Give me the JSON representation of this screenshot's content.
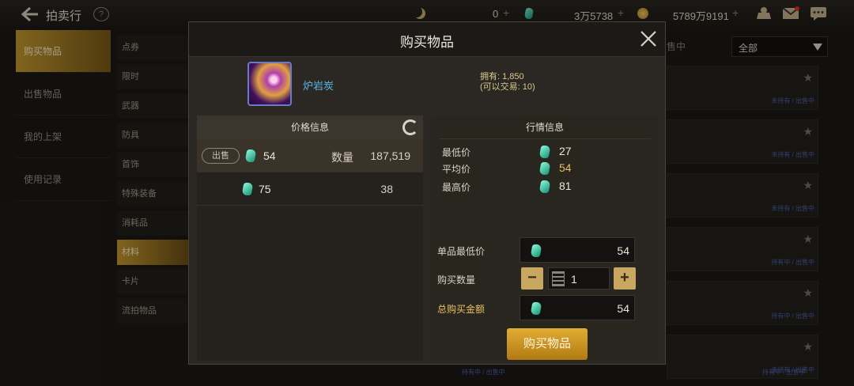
{
  "header": {
    "title": "拍卖行",
    "currency_moon": "0",
    "currency_gem": "3万5738",
    "currency_gold": "5789万9191"
  },
  "sidebar": {
    "items": [
      {
        "label": "购买物品"
      },
      {
        "label": "出售物品"
      },
      {
        "label": "我的上架"
      },
      {
        "label": "使用记录"
      }
    ]
  },
  "categories": [
    {
      "label": "点券"
    },
    {
      "label": "限时"
    },
    {
      "label": "武器"
    },
    {
      "label": "防具"
    },
    {
      "label": "首饰"
    },
    {
      "label": "特殊装备"
    },
    {
      "label": "消耗品"
    },
    {
      "label": "材料"
    },
    {
      "label": "卡片"
    },
    {
      "label": "流拍物品"
    }
  ],
  "list": {
    "filter_label": "售中",
    "filter_value": "全部",
    "row_statuses": [
      "未持有 / 出售中",
      "未持有 / 出售中",
      "未持有 / 出售中",
      "持有中 / 出售中",
      "持有中 / 出售中",
      "未持有 / 出售中"
    ],
    "bottom_status_left": "持有中 / 出售中",
    "bottom_status_right": "持有中 / 出售中"
  },
  "modal": {
    "title": "购买物品",
    "item_name": "炉岩炭",
    "owned": "拥有: 1,850",
    "tradable": "(可以交易: 10)",
    "price_panel": {
      "header": "价格信息",
      "rows": [
        {
          "tag": "出售",
          "price": "54",
          "qty_label": "数量",
          "qty": "187,519"
        },
        {
          "price": "75",
          "qty": "38"
        }
      ]
    },
    "market_panel": {
      "header": "行情信息",
      "min_label": "最低价",
      "min": "27",
      "avg_label": "平均价",
      "avg": "54",
      "max_label": "最高价",
      "max": "81"
    },
    "form": {
      "unit_label": "单品最低价",
      "unit_price": "54",
      "qty_label": "购买数量",
      "qty": "1",
      "total_label": "总购买金额",
      "total": "54"
    },
    "buy_label": "购买物品"
  },
  "colors": {
    "accent_gold": "#e8c060",
    "gem_green": "#2ad0a0",
    "item_name_blue": "#5ab8e8"
  }
}
